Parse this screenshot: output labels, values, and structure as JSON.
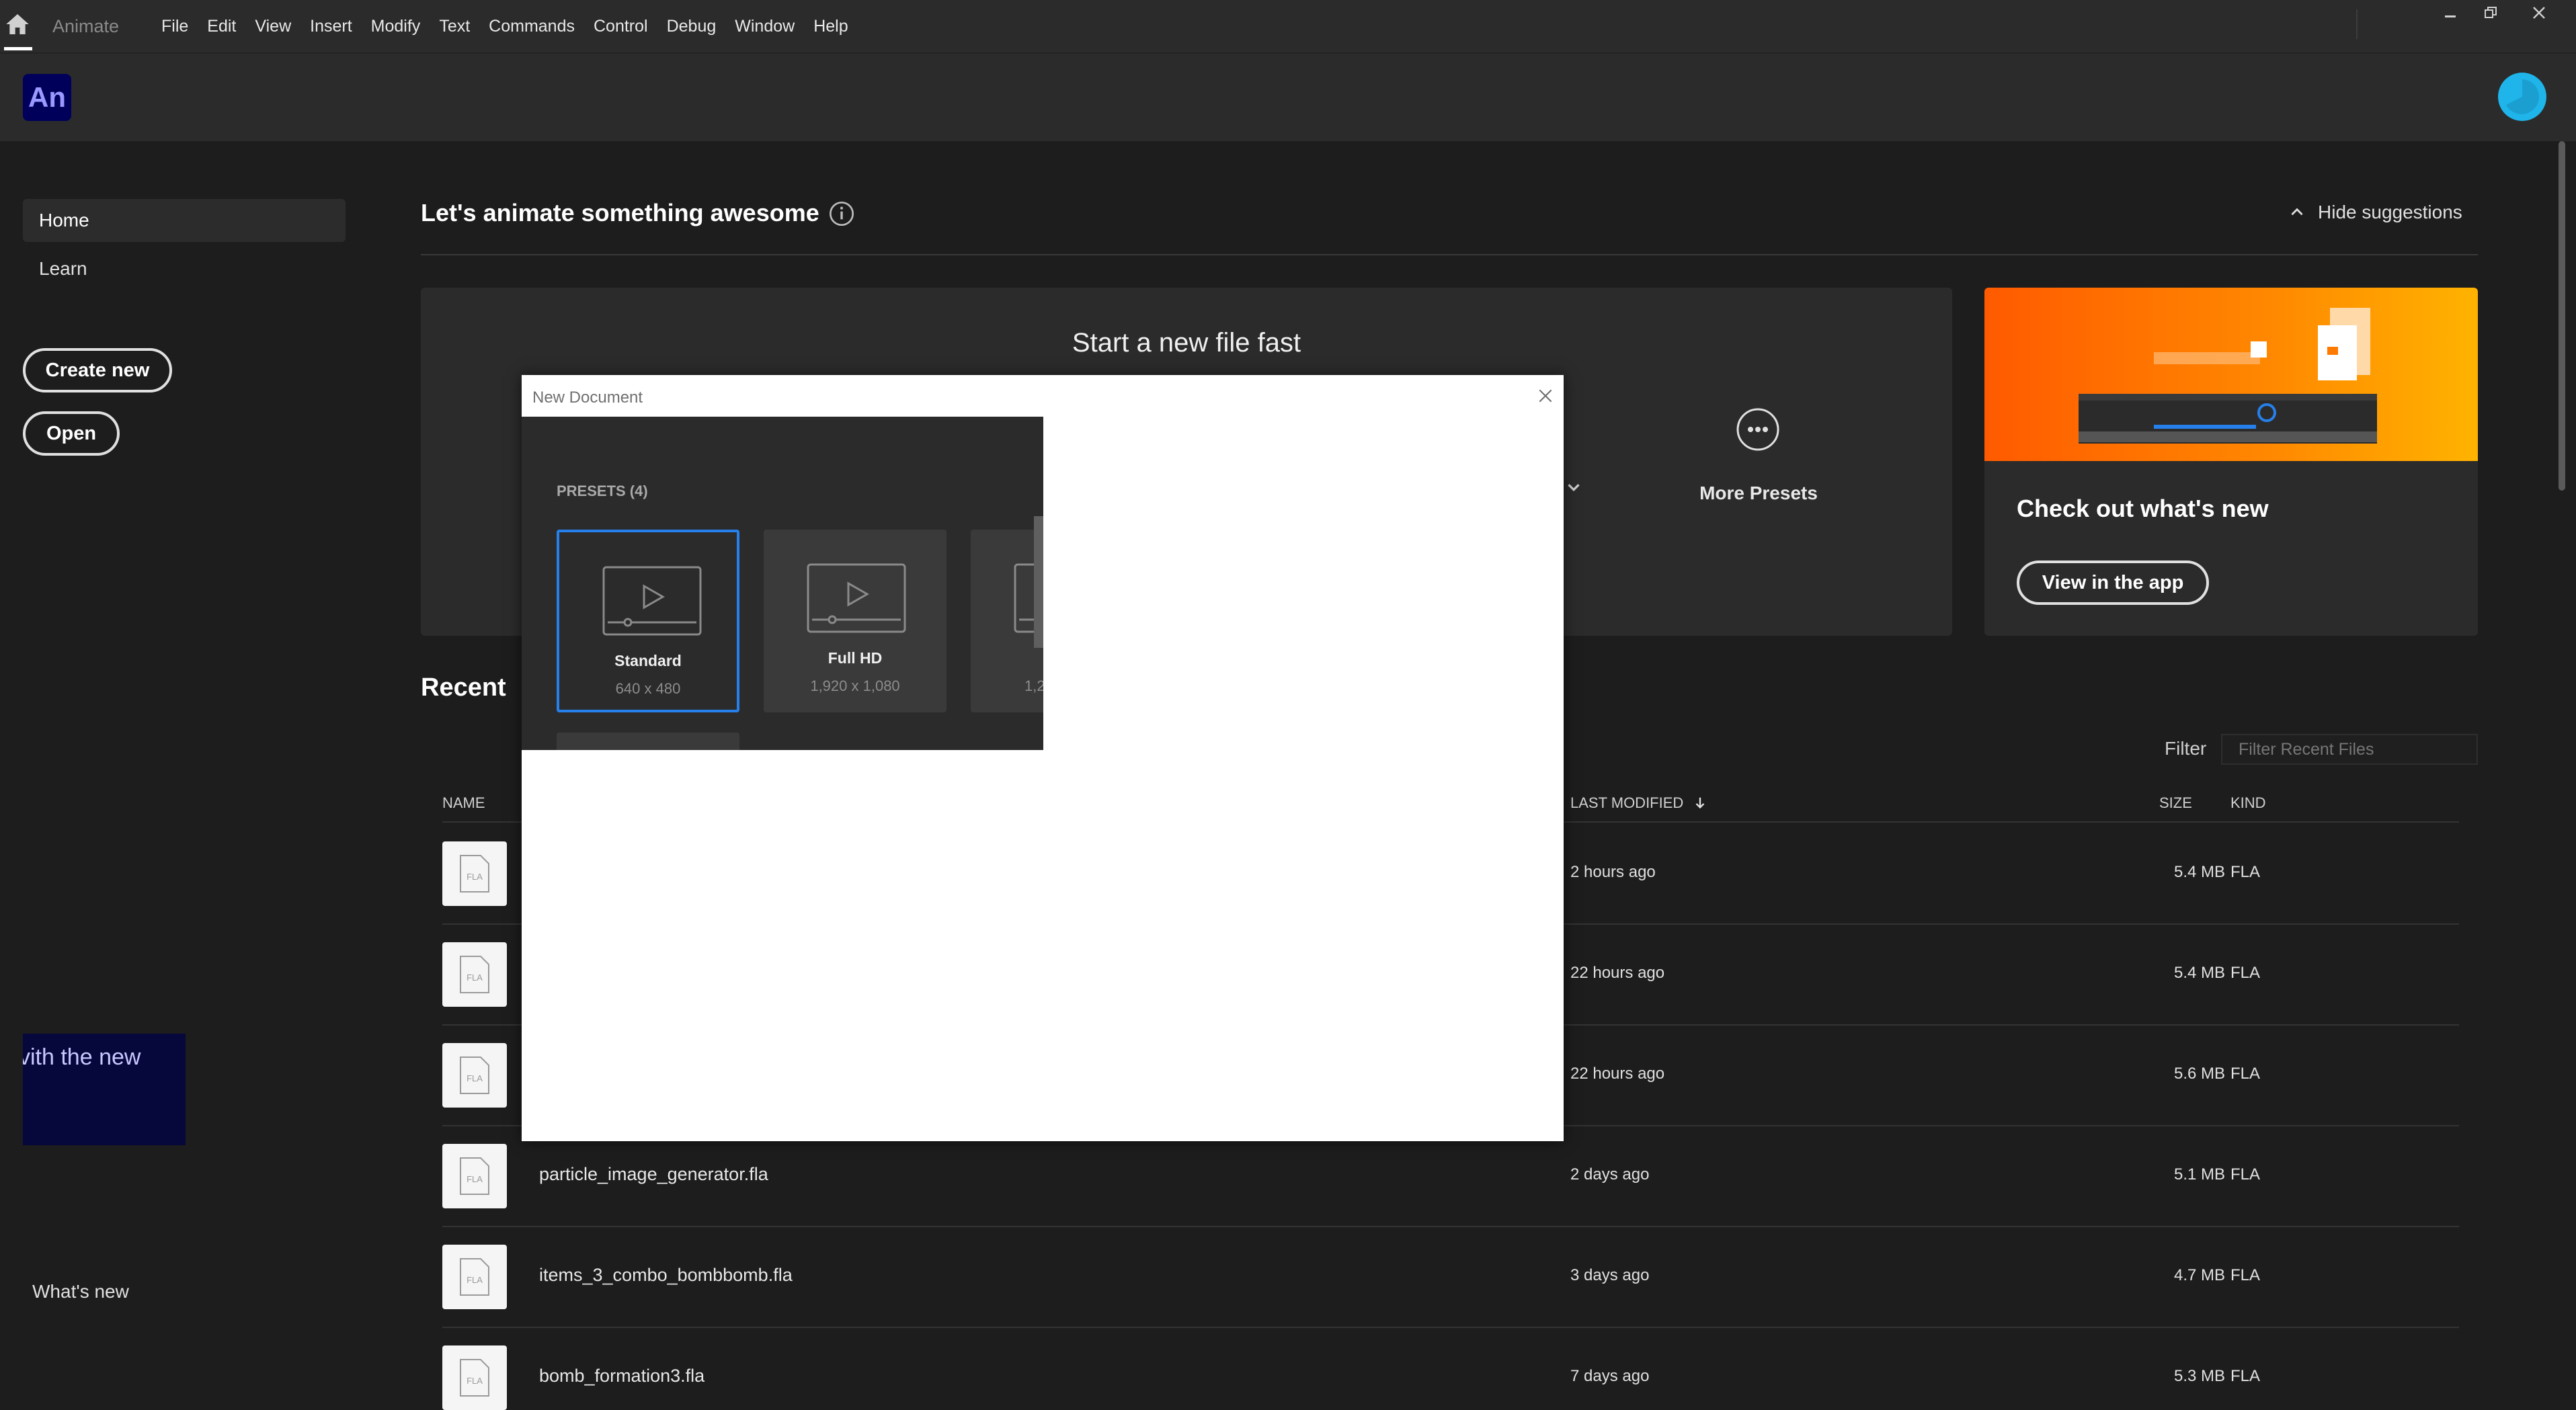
{
  "app": {
    "title": "Animate",
    "logo_text": "An"
  },
  "menu": [
    "File",
    "Edit",
    "View",
    "Insert",
    "Modify",
    "Text",
    "Commands",
    "Control",
    "Debug",
    "Window",
    "Help"
  ],
  "sidebar": {
    "items": [
      {
        "label": "Home"
      },
      {
        "label": "Learn"
      }
    ],
    "create_new": "Create new",
    "open": "Open",
    "promo_text": "vith the new",
    "whats_new": "What's new"
  },
  "main": {
    "title": "Let's animate something awesome",
    "hide_suggestions": "Hide suggestions",
    "quick_start_title": "Start a new file fast",
    "more_presets": "More Presets",
    "whats_new_card": {
      "title": "Check out what's new",
      "button": "View in the app"
    }
  },
  "recent": {
    "title": "Recent",
    "filter_label": "Filter",
    "filter_placeholder": "Filter Recent Files",
    "columns": {
      "name": "NAME",
      "modified": "LAST MODIFIED",
      "size": "SIZE",
      "kind": "KIND"
    },
    "rows": [
      {
        "name": "",
        "modified": "2 hours ago",
        "size": "5.4 MB",
        "kind": "FLA"
      },
      {
        "name": "",
        "modified": "22 hours ago",
        "size": "5.4 MB",
        "kind": "FLA"
      },
      {
        "name": "",
        "modified": "22 hours ago",
        "size": "5.6 MB",
        "kind": "FLA"
      },
      {
        "name": "particle_image_generator.fla",
        "modified": "2 days ago",
        "size": "5.1 MB",
        "kind": "FLA"
      },
      {
        "name": "items_3_combo_bombbomb.fla",
        "modified": "3 days ago",
        "size": "4.7 MB",
        "kind": "FLA"
      },
      {
        "name": "bomb_formation3.fla",
        "modified": "7 days ago",
        "size": "5.3 MB",
        "kind": "FLA"
      }
    ],
    "thumb_text": "FLA"
  },
  "dialog": {
    "title": "New Document",
    "presets_label": "PRESETS (4)",
    "presets": [
      {
        "name": "Standard",
        "size": "640 x 480",
        "selected": true
      },
      {
        "name": "Full HD",
        "size": "1,920 x 1,080",
        "selected": false
      },
      {
        "name": "",
        "size": "1,2",
        "selected": false
      },
      {
        "name": "",
        "size": "",
        "selected": false
      }
    ]
  },
  "colors": {
    "accent": "#2680eb",
    "logo_bg": "#00005b",
    "banner": "#ff8a00",
    "avatar": "#1fb5ea"
  }
}
